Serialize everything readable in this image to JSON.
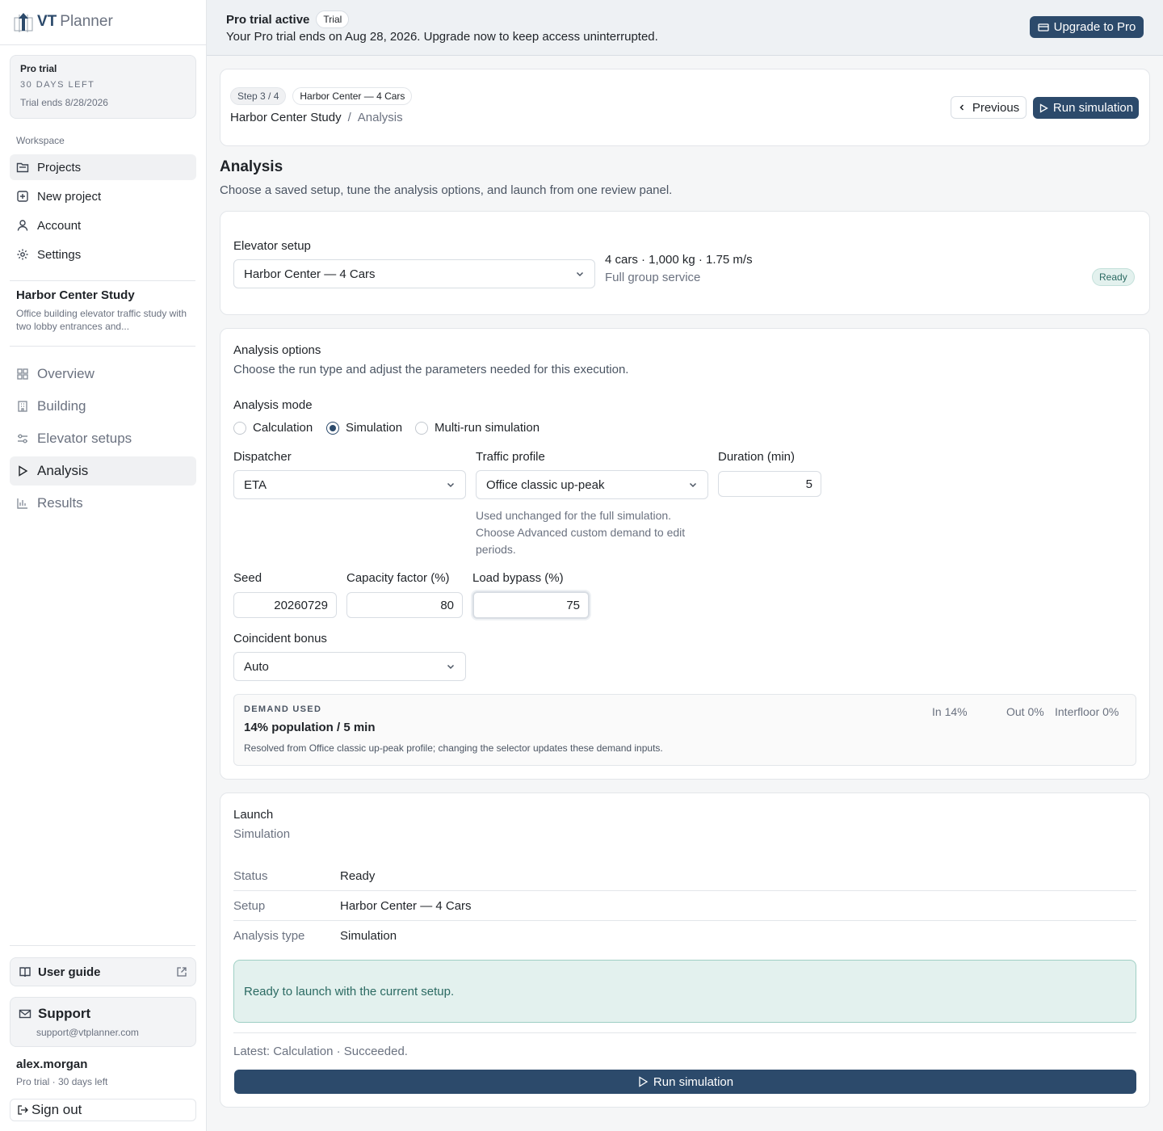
{
  "app": {
    "logo_vt": "VT",
    "logo_planner": "Planner"
  },
  "trial_card": {
    "title": "Pro trial",
    "days_left": "30 DAYS LEFT",
    "ends": "Trial ends 8/28/2026"
  },
  "sidebar": {
    "section_label": "Workspace",
    "workspace_items": [
      {
        "label": "Projects",
        "icon": "folder-icon"
      },
      {
        "label": "New project",
        "icon": "plus-square-icon"
      },
      {
        "label": "Account",
        "icon": "user-icon"
      },
      {
        "label": "Settings",
        "icon": "gear-icon"
      }
    ],
    "project": {
      "title": "Harbor Center Study",
      "description": "Office building elevator traffic study with two lobby entrances and..."
    },
    "project_items": [
      {
        "label": "Overview",
        "icon": "grid-icon"
      },
      {
        "label": "Building",
        "icon": "building-icon"
      },
      {
        "label": "Elevator setups",
        "icon": "sliders-icon"
      },
      {
        "label": "Analysis",
        "icon": "play-icon"
      },
      {
        "label": "Results",
        "icon": "bar-chart-icon"
      }
    ],
    "user_guide": "User guide",
    "support": {
      "title": "Support",
      "email": "support@vtplanner.com"
    },
    "user": {
      "name": "alex.morgan",
      "plan": "Pro trial · 30 days left"
    },
    "sign_out": "Sign out"
  },
  "banner": {
    "title": "Pro trial active",
    "badge": "Trial",
    "message": "Your Pro trial ends on Aug 28, 2026. Upgrade now to keep access uninterrupted.",
    "upgrade_label": "Upgrade to Pro"
  },
  "header": {
    "step": "Step 3 / 4",
    "setup_pill": "Harbor Center — 4 Cars",
    "breadcrumb_project": "Harbor Center Study",
    "breadcrumb_sep": "/",
    "breadcrumb_page": "Analysis",
    "previous_label": "Previous",
    "run_label": "Run simulation"
  },
  "page": {
    "title": "Analysis",
    "subtitle": "Choose a saved setup, tune the analysis options, and launch from one review panel."
  },
  "setup": {
    "label": "Elevator setup",
    "selected": "Harbor Center — 4 Cars",
    "summary": "4 cars · 1,000 kg · 1.75 m/s",
    "service": "Full group service",
    "status": "Ready"
  },
  "options": {
    "title": "Analysis options",
    "subtitle": "Choose the run type and adjust the parameters needed for this execution.",
    "mode_label": "Analysis mode",
    "modes": [
      "Calculation",
      "Simulation",
      "Multi-run simulation"
    ],
    "selected_mode": "Simulation",
    "dispatcher": {
      "label": "Dispatcher",
      "value": "ETA"
    },
    "traffic": {
      "label": "Traffic profile",
      "value": "Office classic up-peak",
      "help": "Used unchanged for the full simulation. Choose Advanced custom demand to edit periods."
    },
    "duration": {
      "label": "Duration (min)",
      "value": "5"
    },
    "seed": {
      "label": "Seed",
      "value": "20260729"
    },
    "capacity": {
      "label": "Capacity factor (%)",
      "value": "80"
    },
    "bypass": {
      "label": "Load bypass (%)",
      "value": "75"
    },
    "coincident": {
      "label": "Coincident bonus",
      "value": "Auto"
    },
    "demand": {
      "heading": "DEMAND USED",
      "summary": "14% population / 5 min",
      "note": "Resolved from Office classic up-peak profile; changing the selector updates these demand inputs.",
      "in": "In 14%",
      "out": "Out 0%",
      "interfloor": "Interfloor 0%"
    }
  },
  "launch": {
    "title": "Launch",
    "subtitle": "Simulation",
    "rows": [
      {
        "key": "Status",
        "value": "Ready"
      },
      {
        "key": "Setup",
        "value": "Harbor Center — 4 Cars"
      },
      {
        "key": "Analysis type",
        "value": "Simulation"
      }
    ],
    "ready_note": "Ready to launch with the current setup.",
    "latest": "Latest: Calculation · Succeeded.",
    "run_label": "Run simulation"
  },
  "colors": {
    "accent": "#2c4a6b",
    "success_bg": "#e3f1ee",
    "success_text": "#2b6a62"
  }
}
